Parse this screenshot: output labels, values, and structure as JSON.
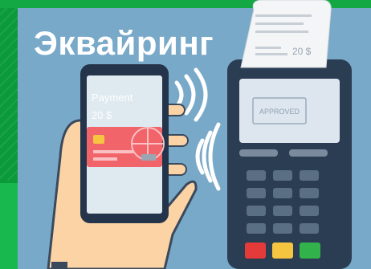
{
  "title": "Эквайринг",
  "phone": {
    "label": "Payment",
    "amount": "20 $"
  },
  "receipt": {
    "amount": "20 $"
  },
  "terminal": {
    "status": "APPROVED"
  },
  "colors": {
    "background_green": "#0a9a3a",
    "panel_blue": "#79a9c9",
    "terminal_dark": "#2b3d52",
    "card_red": "#f0646a",
    "skin": "#fbd3a4",
    "button_red": "#e53a3a",
    "button_yellow": "#f5c542",
    "button_green": "#32b24b"
  }
}
